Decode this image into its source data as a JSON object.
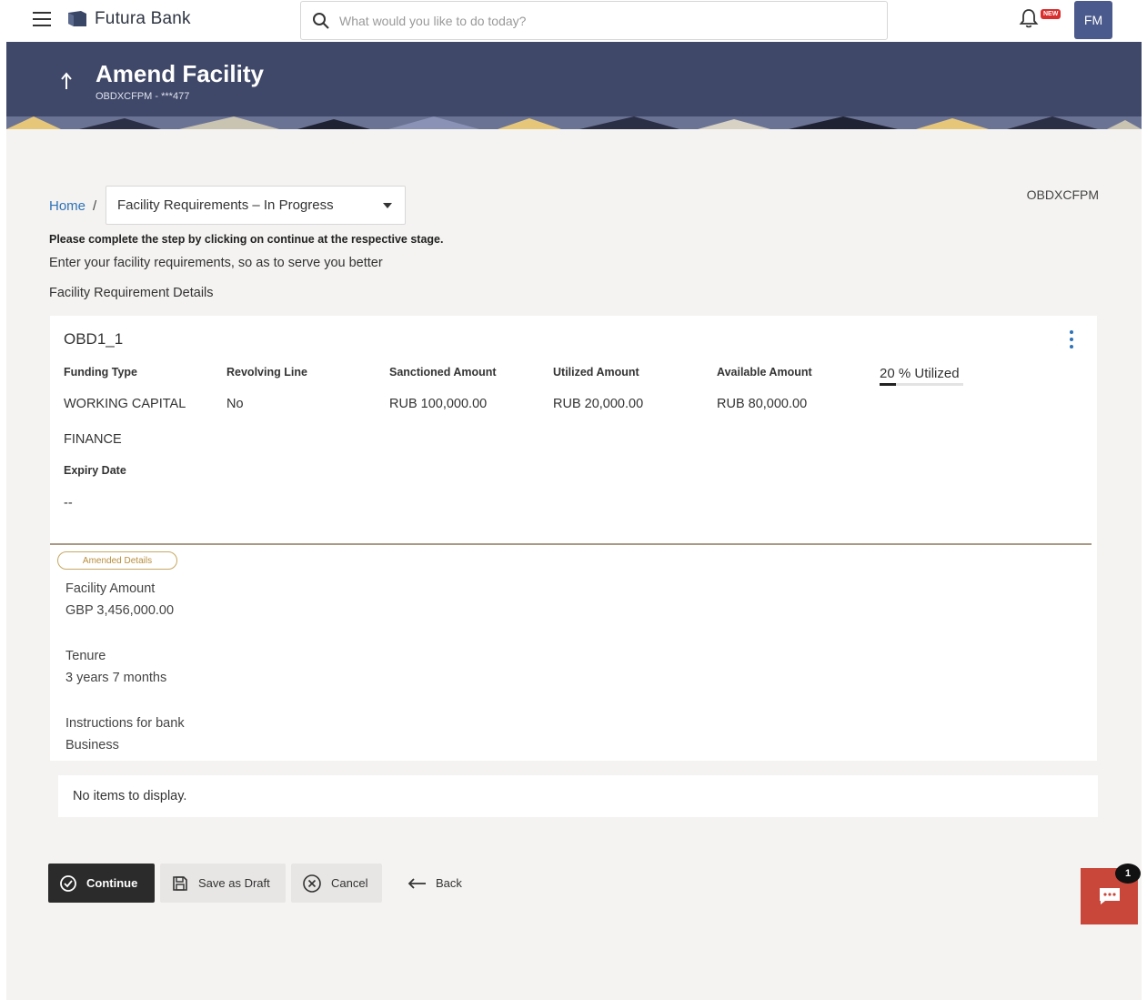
{
  "topbar": {
    "brand": "Futura Bank",
    "search_placeholder": "What would you like to do today?",
    "notification_badge": "NEW",
    "avatar_initials": "FM"
  },
  "header": {
    "title": "Amend Facility",
    "subtitle": "OBDXCFPM - ***477"
  },
  "breadcrumb": {
    "home": "Home",
    "separator": "/",
    "stage": "Facility Requirements – In Progress"
  },
  "application_id": "OBDXCFPM",
  "instruction": "Please complete the step by clicking on continue at the respective stage.",
  "help_text": "Enter your facility requirements, so as to serve you better",
  "section_title": "Facility Requirement Details",
  "facility": {
    "id": "OBD1_1",
    "columns": {
      "funding_type": "Funding Type",
      "revolving_line": "Revolving Line",
      "sanctioned_amount": "Sanctioned Amount",
      "utilized_amount": "Utilized Amount",
      "available_amount": "Available Amount"
    },
    "values": {
      "funding_type_line1": "WORKING CAPITAL",
      "funding_type_line2": "FINANCE",
      "revolving_line": "No",
      "sanctioned_amount": "RUB 100,000.00",
      "utilized_amount": "RUB 20,000.00",
      "available_amount": "RUB 80,000.00"
    },
    "utilization_label": "20 % Utilized",
    "utilization_fraction": 0.2,
    "expiry_label": "Expiry Date",
    "expiry_value": "--",
    "amended_tag": "Amended Details",
    "amended": {
      "facility_amount_label": "Facility Amount",
      "facility_amount_value": "GBP 3,456,000.00",
      "tenure_label": "Tenure",
      "tenure_value": "3 years 7 months",
      "instructions_label": "Instructions for bank",
      "instructions_value": "Business"
    }
  },
  "no_items": "No items to display.",
  "actions": {
    "continue": "Continue",
    "save_draft": "Save as Draft",
    "cancel": "Cancel",
    "back": "Back"
  },
  "chat": {
    "badge": "1"
  },
  "colors": {
    "header_bg": "#3f4868",
    "avatar_bg": "#4b5a8c",
    "link": "#2e73b8",
    "chat_bg": "#c9473a",
    "primary_button": "#2b2b2b"
  }
}
